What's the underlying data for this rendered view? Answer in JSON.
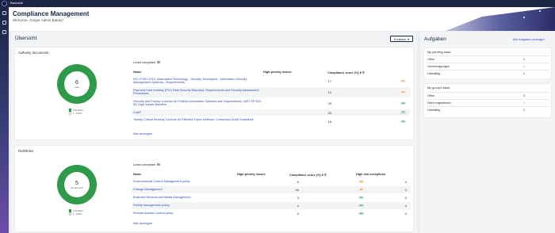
{
  "app": {
    "brand": "Baxhalle",
    "title": "Compliance Management",
    "welcome": "Welcome, Ginger Admin Baldur!"
  },
  "sidebar": {
    "icons": [
      "home-icon",
      "dashboard-icon",
      "settings-icon"
    ]
  },
  "overview": {
    "title": "Übersicht",
    "create_label": "Erstellen"
  },
  "authority": {
    "title": "Authority documents",
    "donut": {
      "value": "6",
      "label": "Aktiv"
    },
    "legend": [
      "Compliant",
      "1 - 100%"
    ],
    "least_compliant": "Least compliant",
    "headers": {
      "name": "Name",
      "hp": "High-priority issues",
      "score": "Compliance score (%)"
    },
    "rows": [
      {
        "name": "ISO 27001:2013, Information Technology - Security Techniques - Information Security Management Systems - Requirements",
        "hp": "17",
        "badge": "97",
        "badge_color": "orange"
      },
      {
        "name": "Payment Card Industry (PCI) Data Security Standard, Requirements and Security Assessment Procedures",
        "hp": "13",
        "badge": "97",
        "badge_color": "orange"
      },
      {
        "name": "Security and Privacy Controls for Federal Information Systems and Organizations, NIST SP 800-53, High Impact Baseline",
        "hp": "29",
        "badge": "99",
        "badge_color": "green"
      },
      {
        "name": "CobiT",
        "hp": "25",
        "badge": "99",
        "badge_color": "green"
      },
      {
        "name": "Twenty Critical Security Controls for Effective Cyber Defense: Consensus Audit Guidelines",
        "hp": "18",
        "badge": "99",
        "badge_color": "green"
      }
    ],
    "show_all": "Alle anzeigen"
  },
  "guidelines": {
    "title": "Richtlinien",
    "donut": {
      "value": "5",
      "label": "Veröffentlicht"
    },
    "legend": [
      "Compliant",
      "1 - 100%"
    ],
    "least_compliant": "Least compliant",
    "headers": {
      "name": "Name",
      "hp": "High-priority issues",
      "score": "Compliance score (%)",
      "exc": "High risk exceptions"
    },
    "rows": [
      {
        "name": "Environmental Control Management policy",
        "hp": "6",
        "badge": "97",
        "badge_color": "orange",
        "exc": "0"
      },
      {
        "name": "Change Management",
        "hp": "46",
        "badge": "98",
        "badge_color": "orange",
        "exc": "0"
      },
      {
        "name": "Business Records and Media Management",
        "hp": "3",
        "badge": "99",
        "badge_color": "green",
        "exc": "0"
      },
      {
        "name": "Facility Management policy",
        "hp": "0",
        "badge": "100",
        "badge_color": "green",
        "exc": "0"
      },
      {
        "name": "Remote Access Control policy",
        "hp": "0",
        "badge": "100",
        "badge_color": "green",
        "exc": "0"
      }
    ],
    "show_all": "Alle anzeigen"
  },
  "tasks": {
    "title": "Aufgaben",
    "show_all": "Alle Aufgaben anzeigen",
    "my_pending": {
      "title": "My pending tasks",
      "rows": [
        {
          "label": "Offen",
          "value": "2"
        },
        {
          "label": "Genehmigungen",
          "value": "0"
        },
        {
          "label": "Überfällig",
          "value": "1"
        }
      ]
    },
    "my_group": {
      "title": "My group's tasks",
      "rows": [
        {
          "label": "Offen",
          "value": "3"
        },
        {
          "label": "Nicht zugewiesen",
          "value": "0"
        },
        {
          "label": "Überfällig",
          "value": "2"
        }
      ]
    }
  },
  "colors": {
    "accent": "#2b4db7",
    "nav": "#1b2440",
    "compliant": "#2e9a4a",
    "badge_orange": "#fde7c6",
    "badge_green": "#cfead6"
  }
}
